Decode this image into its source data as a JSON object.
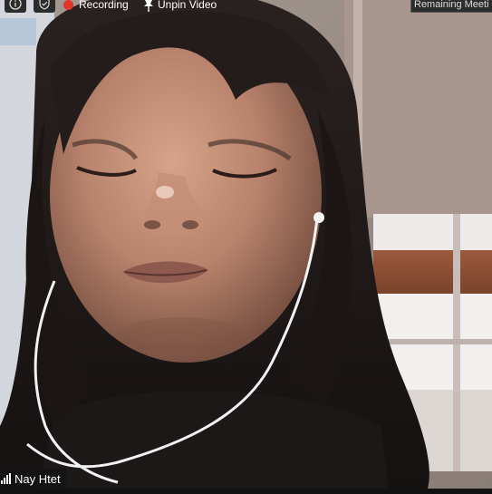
{
  "toolbar": {
    "info_icon": "info-icon",
    "shield_icon": "shield-check-icon",
    "recording_label": "Recording",
    "recording_color": "#e0352b",
    "unpin_label": "Unpin Video",
    "pin_icon": "pin-icon",
    "remaining_label": "Remaining Meeti"
  },
  "participant": {
    "name": "Nay Htet",
    "signal_icon": "signal-bars-icon"
  }
}
